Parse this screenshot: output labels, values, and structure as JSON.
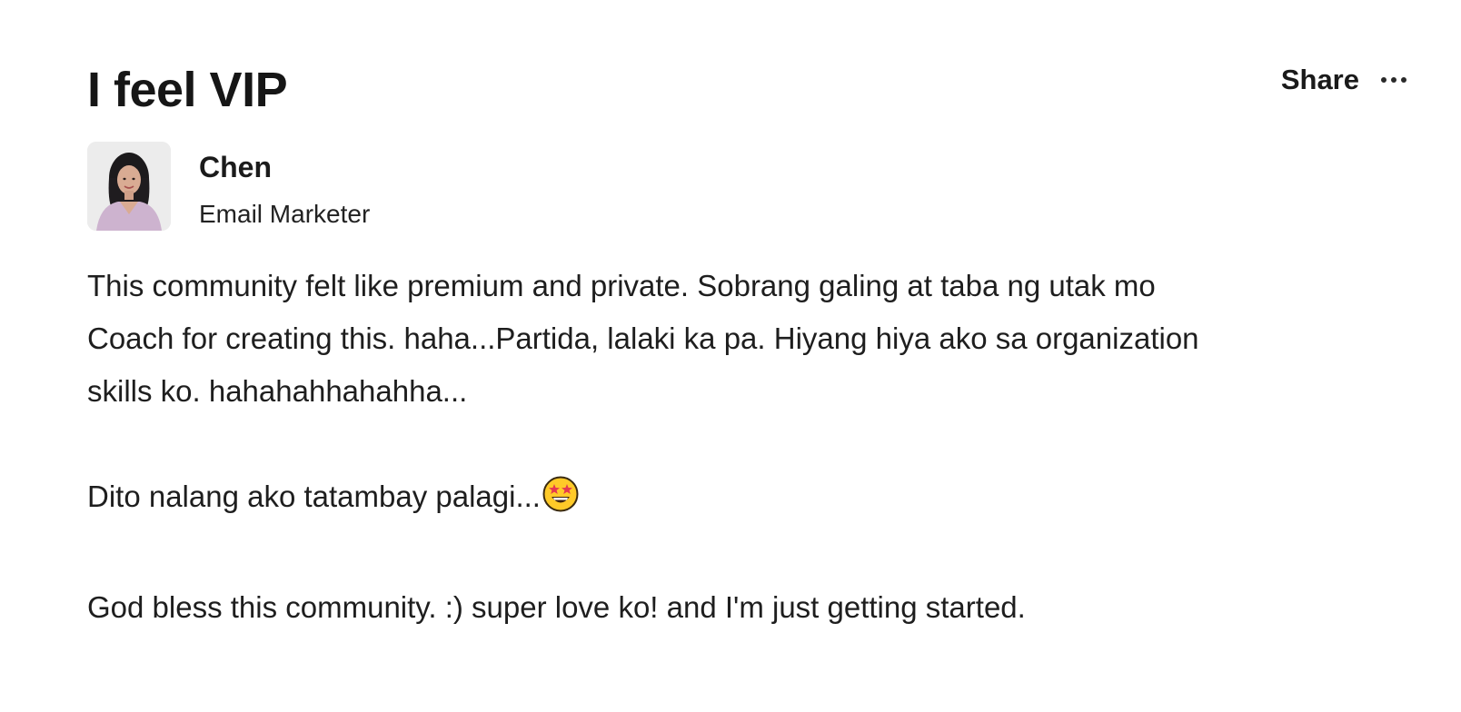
{
  "post": {
    "title": "I feel VIP",
    "share_label": "Share",
    "author": {
      "name": "Chen",
      "role": "Email Marketer"
    },
    "body": {
      "paragraph_1_line_1": "This community felt like premium and private. Sobrang galing at taba ng utak mo",
      "paragraph_1_line_2": "Coach for creating this. haha...Partida, lalaki ka pa. Hiyang hiya ako sa organization",
      "paragraph_1_line_3": "skills ko. hahahahhahahha...",
      "paragraph_2": "Dito nalang ako tatambay palagi...",
      "paragraph_3": "God bless this community. :) super love ko! and I'm just getting started."
    }
  },
  "icons": {
    "more": "more-horizontal-icon",
    "emoji": "star-struck-emoji-icon"
  },
  "colors": {
    "text": "#1e1e1e",
    "background": "#ffffff"
  }
}
